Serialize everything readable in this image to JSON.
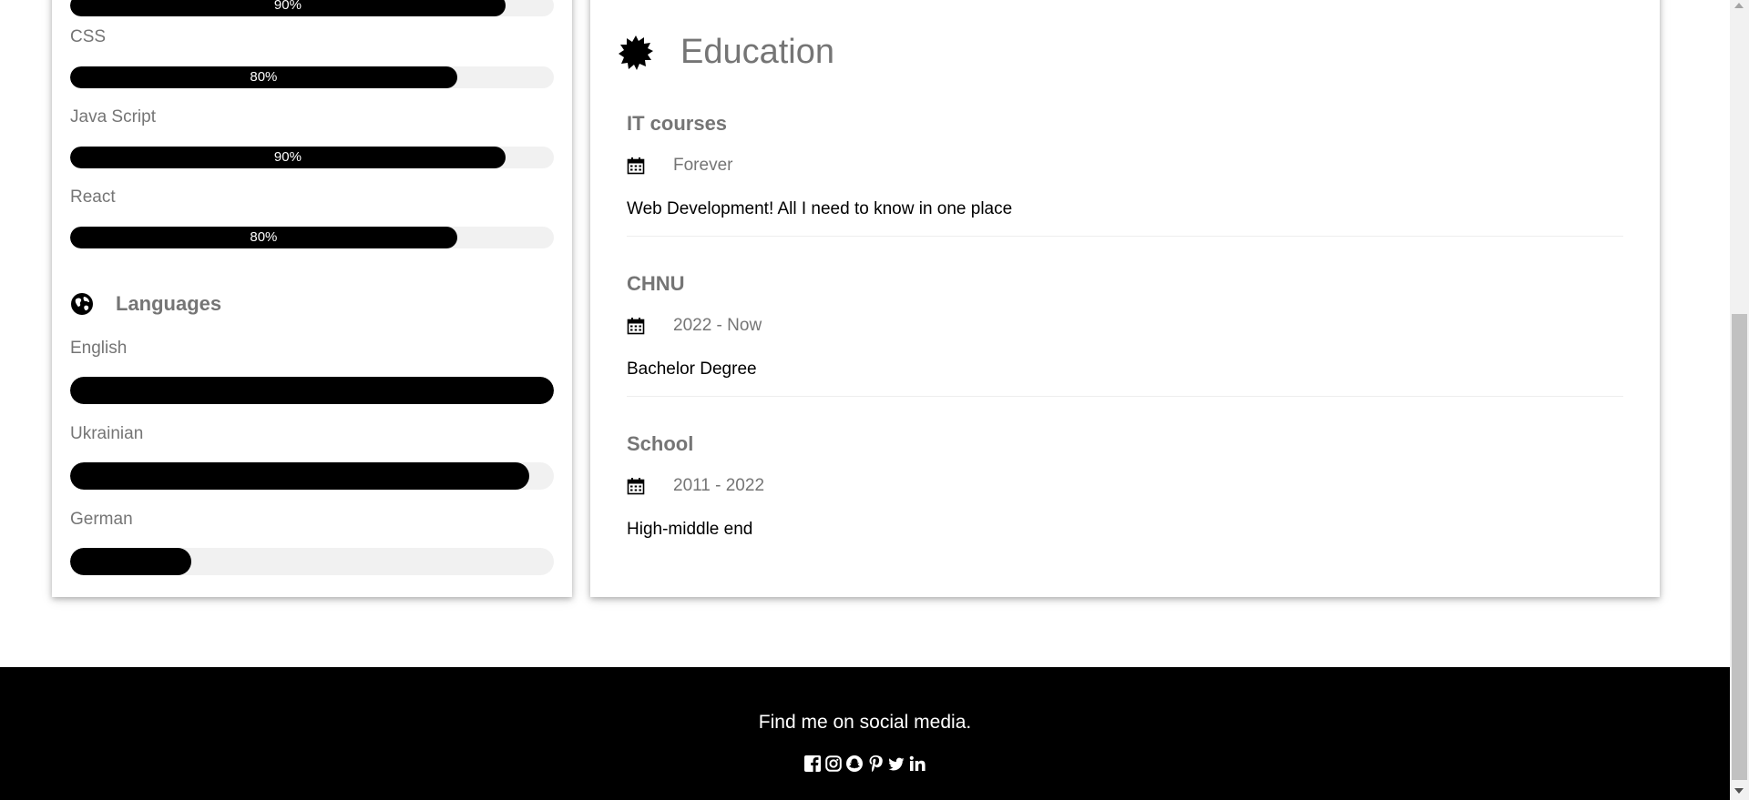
{
  "skills": {
    "items": [
      {
        "label": "",
        "percent_label": "90%",
        "level": 0.9
      },
      {
        "label": "CSS",
        "percent_label": "80%",
        "level": 0.8
      },
      {
        "label": "Java Script",
        "percent_label": "90%",
        "level": 0.9
      },
      {
        "label": "React",
        "percent_label": "80%",
        "level": 0.8
      }
    ]
  },
  "languages": {
    "title": "Languages",
    "icon": "globe-icon",
    "items": [
      {
        "label": "English",
        "level": 1.0
      },
      {
        "label": "Ukrainian",
        "level": 0.95
      },
      {
        "label": "German",
        "level": 0.25
      }
    ]
  },
  "education": {
    "title": "Education",
    "icon": "certificate-icon",
    "entries": [
      {
        "title": "IT courses",
        "date": "Forever",
        "description": "Web Development! All I need to know in one place"
      },
      {
        "title": "CHNU",
        "date": "2022 - Now",
        "description": "Bachelor Degree"
      },
      {
        "title": "School",
        "date": "2011 - 2022",
        "description": "High-middle end"
      }
    ]
  },
  "footer": {
    "tagline": "Find me on social media.",
    "social_icons": [
      "facebook-icon",
      "instagram-icon",
      "snapchat-icon",
      "pinterest-icon",
      "twitter-icon",
      "linkedin-icon"
    ]
  },
  "colors": {
    "bar_fill": "#000000",
    "bar_track": "#f1f1f1",
    "text_muted": "#757575",
    "footer_bg": "#000000"
  }
}
